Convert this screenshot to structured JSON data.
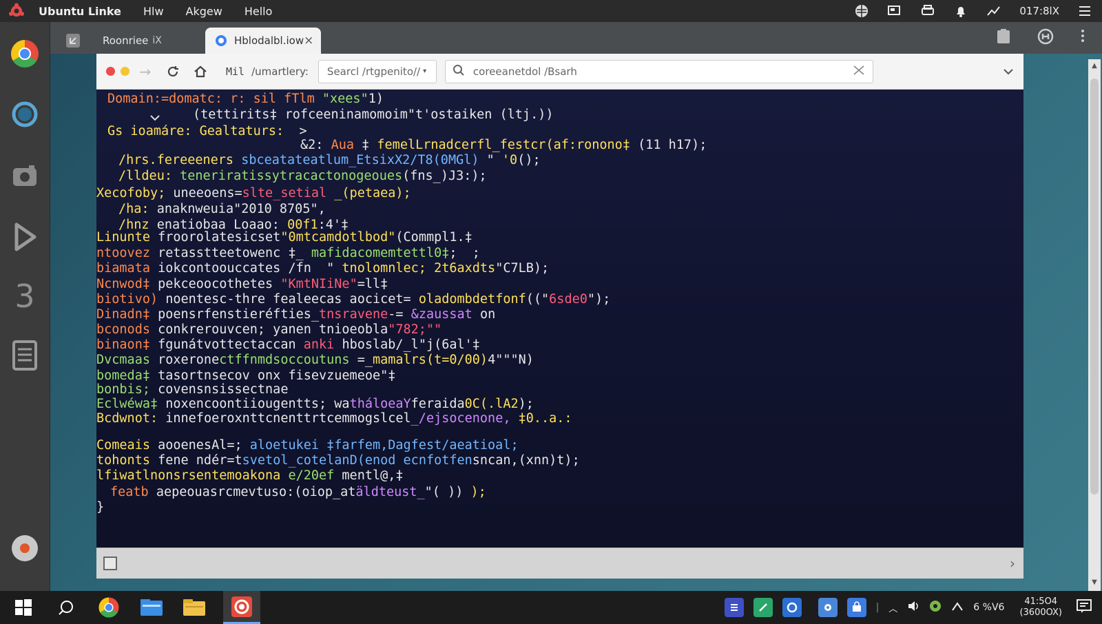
{
  "topbar": {
    "app_name": "Ubuntu Linke",
    "menus": [
      "Hlw",
      "Akgew",
      "Hello"
    ],
    "clock": "017:8lX"
  },
  "tabs": [
    {
      "label": "Roonriee",
      "close": "iX"
    },
    {
      "label": "Hblodalbl.iow",
      "close": "×"
    }
  ],
  "toolbar": {
    "crumb": "Mil",
    "crumb2": "/umartlery:",
    "select_label": "Searcl /rtgpenito//",
    "search_value": "coreeanetdol /Bsarh"
  },
  "code_lines": [
    {
      "indent": 16,
      "segs": [
        [
          "o",
          "Domain:=domatc: r: sil fTlm "
        ],
        [
          "g",
          "\"xees\""
        ],
        [
          "w",
          "1)"
        ]
      ]
    },
    {
      "indent": 140,
      "segs": [
        [
          "w",
          "(tettirits‡ rofceeninamomoim\"t'ostaiken (ltj.))"
        ]
      ]
    },
    {
      "indent": 16,
      "segs": [
        [
          "y",
          "Gs ioamáre: Gealtaturs:  "
        ],
        [
          "w",
          ">"
        ]
      ]
    },
    {
      "indent": 296,
      "segs": [
        [
          "w",
          "&2: "
        ],
        [
          "o",
          "Aua "
        ],
        [
          "w",
          "‡ "
        ],
        [
          "y",
          "femelLrnadcerfl_festcr(af:ronono‡ "
        ],
        [
          "w",
          "(11 h17);"
        ]
      ]
    },
    {
      "indent": 32,
      "segs": [
        [
          "y",
          "/hrs.fereeeners "
        ],
        [
          "b",
          "sbceatateatlum_EtsixX2/T8(0MGl)"
        ],
        [
          "w",
          " \" "
        ],
        [
          "y",
          "'0"
        ],
        [
          "w",
          "();"
        ]
      ]
    },
    {
      "indent": 32,
      "segs": [
        [
          "y",
          "/lldeu: "
        ],
        [
          "g",
          "teneriratissytracactonogeoues"
        ],
        [
          "w",
          "(fns_)J3:);"
        ]
      ]
    },
    {
      "indent": 0,
      "segs": [
        [
          "y",
          "Xecofoby; "
        ],
        [
          "w",
          "uneeoens="
        ],
        [
          "r",
          "slte_setial "
        ],
        [
          "y",
          "_(petaea);"
        ]
      ]
    },
    {
      "indent": 32,
      "segs": [
        [
          "y",
          "/ha: "
        ],
        [
          "w",
          "anaknweuia\"2010 8705\","
        ]
      ]
    },
    {
      "indent": 32,
      "segs": [
        [
          "y",
          "/hnz "
        ],
        [
          "w",
          "enatiobaa Loaao: "
        ],
        [
          "y",
          "00f1"
        ],
        [
          "w",
          ":4'‡"
        ]
      ]
    },
    {
      "indent": 0,
      "segs": [
        [
          "y",
          "Linunte "
        ],
        [
          "w",
          "froorolatesicset"
        ],
        [
          "y",
          "\"0mtcamdotlbod\""
        ],
        [
          "w",
          "(Commpl1.‡"
        ]
      ]
    },
    {
      "indent": 0,
      "segs": [
        [
          "o",
          "ntoovez "
        ],
        [
          "w",
          "retasstteetowenc ‡_ "
        ],
        [
          "g",
          "mafidacomemtettl0‡"
        ],
        [
          "w",
          ";  ;"
        ]
      ]
    },
    {
      "indent": 0,
      "segs": [
        [
          "o",
          "biamata "
        ],
        [
          "w",
          "iokcontoouccates /fn  \" "
        ],
        [
          "y",
          "tnolomnlec; 2t6axdts"
        ],
        [
          "w",
          "\"C7LB);"
        ]
      ]
    },
    {
      "indent": 0,
      "segs": [
        [
          "o",
          "Ncnwod‡ "
        ],
        [
          "w",
          "pekceoocothetes "
        ],
        [
          "r",
          "\"KmtNIiNe\""
        ],
        [
          "w",
          "=ll‡"
        ]
      ]
    },
    {
      "indent": 0,
      "segs": [
        [
          "o",
          "biotivo) "
        ],
        [
          "w",
          "noentesc-thre fealeecas aocicet= "
        ],
        [
          "y",
          "oladombdetfonf"
        ],
        [
          "w",
          "((\""
        ],
        [
          "r",
          "6sde0"
        ],
        [
          "w",
          "\");"
        ]
      ]
    },
    {
      "indent": 0,
      "segs": [
        [
          "o",
          "Dinadn‡ "
        ],
        [
          "w",
          "poensrfenstieréfties_"
        ],
        [
          "r",
          "tnsravene"
        ],
        [
          "w",
          "-= "
        ],
        [
          "p",
          "&zaussat "
        ],
        [
          "w",
          "on"
        ]
      ]
    },
    {
      "indent": 0,
      "segs": [
        [
          "o",
          "bconods "
        ],
        [
          "w",
          "conkrerouvcen; yanen tnioeobla"
        ],
        [
          "r",
          "\"782;\"\""
        ]
      ]
    },
    {
      "indent": 0,
      "segs": [
        [
          "o",
          "binaon‡ "
        ],
        [
          "w",
          "fgunátvottectaccan "
        ],
        [
          "r",
          "anki "
        ],
        [
          "w",
          "hboslab/_l\"j(6al'‡"
        ]
      ]
    },
    {
      "indent": 0,
      "segs": [
        [
          "g",
          "Dvcmaas "
        ],
        [
          "w",
          "roxerone"
        ],
        [
          "g",
          "ctffnmdsoccoutuns "
        ],
        [
          "w",
          "=_"
        ],
        [
          "y",
          "mamalrs(t=0/00)"
        ],
        [
          "w",
          "4\"\"\"N)"
        ]
      ]
    },
    {
      "indent": 0,
      "segs": [
        [
          "g",
          "bomeda‡ "
        ],
        [
          "w",
          "tasortnsecov onx fisevzuemeoe\"‡"
        ]
      ]
    },
    {
      "indent": 0,
      "segs": [
        [
          "g",
          "bonbis; "
        ],
        [
          "w",
          "covensnsissectnae"
        ]
      ]
    },
    {
      "indent": 0,
      "segs": [
        [
          "g",
          "Eclwéwa‡ "
        ],
        [
          "w",
          "noxencoontiiougentts; wa"
        ],
        [
          "p",
          "tháloeaY"
        ],
        [
          "w",
          "feraida"
        ],
        [
          "y",
          "0C(.lA2"
        ],
        [
          "w",
          ");"
        ]
      ]
    },
    {
      "indent": 0,
      "segs": [
        [
          "y",
          "Bcdwnot: "
        ],
        [
          "w",
          "innefoeroxnttcnenttrtcemmogslcel"
        ],
        [
          "p",
          "_/ejsocenone, "
        ],
        [
          "y",
          "‡0..a.:"
        ]
      ]
    },
    {
      "indent": 0,
      "segs": [
        [
          "y",
          "Comeais "
        ],
        [
          "w",
          "aooenesAl=; "
        ],
        [
          "b",
          "aloetukei ‡farfem,Dagfest/aeatioal;"
        ]
      ]
    },
    {
      "indent": 0,
      "segs": [
        [
          "y",
          "tohonts "
        ],
        [
          "w",
          "fene ndér=t"
        ],
        [
          "b",
          "svetol_cotelanD(enod ecnfotfen"
        ],
        [
          "w",
          "sncan,(xnn)t);"
        ]
      ]
    },
    {
      "indent": 0,
      "segs": [
        [
          "y",
          "lfiwatlnonsrsentemoakona "
        ],
        [
          "g",
          "e/20ef "
        ],
        [
          "w",
          "mentl@,‡"
        ]
      ]
    },
    {
      "indent": 20,
      "segs": [
        [
          "o",
          "featb "
        ],
        [
          "w",
          "aepeouasrcmevtuso:(oiop_at"
        ],
        [
          "p",
          "äldteust_"
        ],
        [
          "w",
          "\"( )) "
        ],
        [
          "y",
          ");"
        ]
      ]
    },
    {
      "indent": 0,
      "segs": [
        [
          "w",
          "}"
        ]
      ]
    }
  ],
  "taskbar": {
    "tray_text": "6 %V6",
    "clock_time": "41:5O4",
    "clock_sub": "(3600OX)"
  }
}
